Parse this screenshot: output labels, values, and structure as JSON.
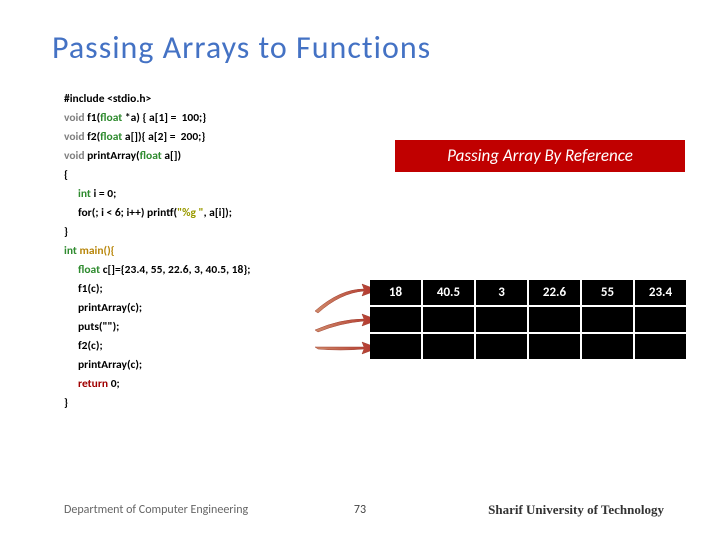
{
  "title": "Passing Arrays to Functions",
  "code": {
    "l1a": "#include ",
    "l1b": "<stdio.h>",
    "l2a": "void",
    "l2b": " f1(",
    "l2c": "float",
    "l2d": " *a) { a[1] =  100;}",
    "l3a": "void",
    "l3b": " f2(",
    "l3c": "float",
    "l3d": " a[]){ a[2] =  200;}",
    "l4a": "void",
    "l4b": " printArray(",
    "l4c": "float",
    "l4d": " a[])",
    "l5": "{",
    "l6a": "int",
    "l6b": " i = 0;",
    "l7a": "for(; i < 6; i++) printf(",
    "l7b": "\"%g \"",
    "l7c": ", a[i]);",
    "l8": "}",
    "l9a": "int",
    "l9b": " main(){",
    "l10a": "float",
    "l10b": " c[]={23.4, 55, 22.6, 3, 40.5, 18};",
    "l11": "f1(c);",
    "l12": "printArray(c);",
    "l13": "puts(\"\");",
    "l14": "f2(c);",
    "l15": "printArray(c);",
    "l16a": "return",
    "l16b": " 0;",
    "l17": "}"
  },
  "badge": "Passing Array By Reference",
  "chart_data": {
    "type": "table",
    "rows": [
      {
        "cells": [
          "18",
          "40.5",
          "3",
          "22.6",
          "55",
          "23.4"
        ]
      },
      {
        "cells": [
          "",
          "",
          "",
          "",
          "",
          ""
        ]
      },
      {
        "cells": [
          "",
          "",
          "",
          "",
          "",
          ""
        ]
      }
    ]
  },
  "footer": {
    "left": "Department of Computer Engineering",
    "page": "73",
    "right": "Sharif University of Technology"
  }
}
